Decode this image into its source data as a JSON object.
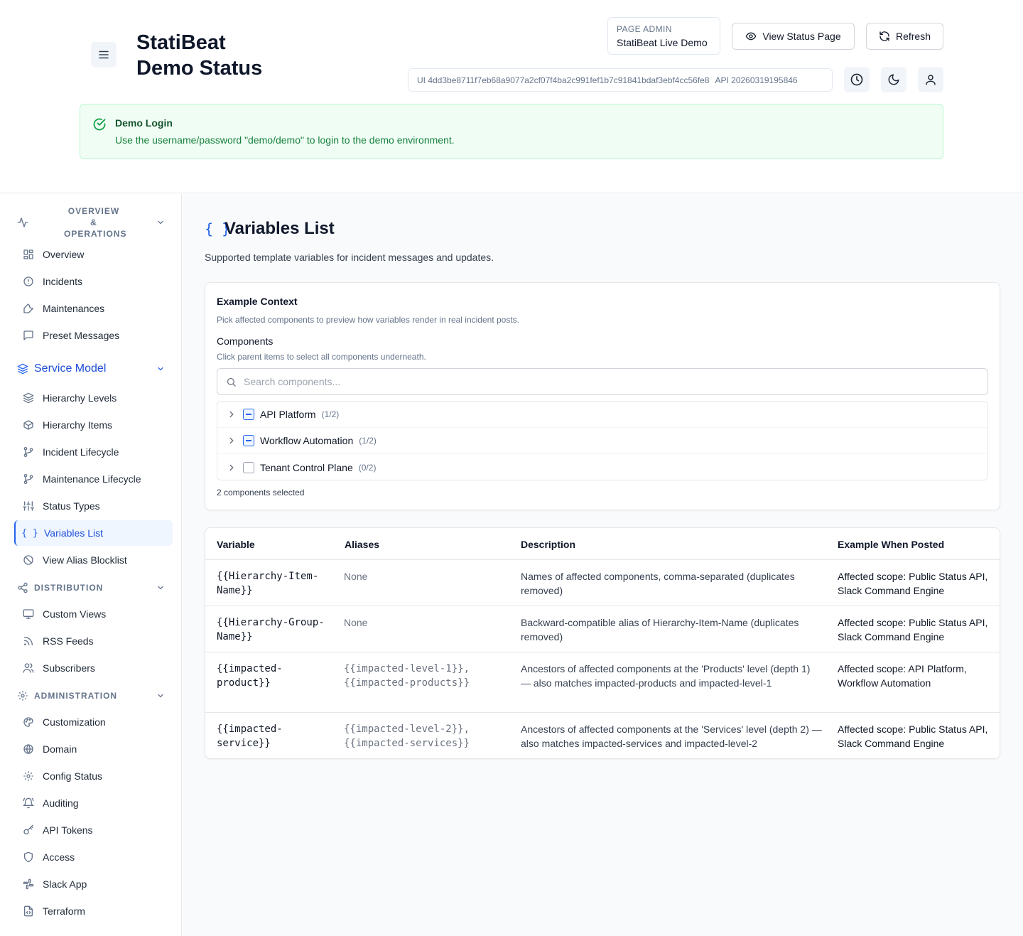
{
  "header": {
    "title_line1": "StatiBeat",
    "title_line2": "Demo Status",
    "page_admin_label": "PAGE ADMIN",
    "page_admin_value": "StatiBeat Live Demo",
    "view_status_label": "View Status Page",
    "refresh_label": "Refresh",
    "ui_version": "UI 4dd3be8711f7eb68a9077a2cf07f4ba2c991fef1b7c91841bdaf3ebf4cc56fe8",
    "api_version": "API 20260319195846"
  },
  "alert": {
    "title": "Demo Login",
    "text": "Use the username/password \"demo/demo\" to login to the demo environment.",
    "color": "#15803d"
  },
  "sidebar": {
    "sections": [
      {
        "label": "OVERVIEW & OPERATIONS",
        "line1": "OVERVIEW &",
        "line2": "OPERATIONS"
      },
      {
        "label": "Service Model"
      },
      {
        "label": "DISTRIBUTION"
      },
      {
        "label": "ADMINISTRATION"
      }
    ],
    "items": [
      {
        "label": "Overview",
        "icon": "grid-icon"
      },
      {
        "label": "Incidents",
        "icon": "alert-circle-icon"
      },
      {
        "label": "Maintenances",
        "icon": "wrench-icon"
      },
      {
        "label": "Preset Messages",
        "icon": "message-square-icon"
      },
      {
        "label": "Hierarchy Levels",
        "icon": "layers-icon"
      },
      {
        "label": "Hierarchy Items",
        "icon": "box-icon"
      },
      {
        "label": "Incident Lifecycle",
        "icon": "git-branch-icon"
      },
      {
        "label": "Maintenance Lifecycle",
        "icon": "git-branch-icon"
      },
      {
        "label": "Status Types",
        "icon": "sliders-icon"
      },
      {
        "label": "Variables List",
        "icon": "braces-icon",
        "active": true
      },
      {
        "label": "View Alias Blocklist",
        "icon": "ban-icon"
      },
      {
        "label": "Custom Views",
        "icon": "monitor-icon"
      },
      {
        "label": "RSS Feeds",
        "icon": "rss-icon"
      },
      {
        "label": "Subscribers",
        "icon": "users-icon"
      },
      {
        "label": "Customization",
        "icon": "palette-icon"
      },
      {
        "label": "Domain",
        "icon": "globe-icon"
      },
      {
        "label": "Config Status",
        "icon": "cog-icon"
      },
      {
        "label": "Auditing",
        "icon": "bell-ring-icon"
      },
      {
        "label": "API Tokens",
        "icon": "key-icon"
      },
      {
        "label": "Access",
        "icon": "shield-icon"
      },
      {
        "label": "Slack App",
        "icon": "slack-icon"
      },
      {
        "label": "Terraform",
        "icon": "file-code-icon"
      }
    ],
    "accent": "#2563eb"
  },
  "main": {
    "title_icon": "{ }",
    "title": "Variables List",
    "subtitle": "Supported template variables for incident messages and updates.",
    "context": {
      "heading": "Example Context",
      "description": "Pick affected components to preview how variables render in real incident posts.",
      "components_label": "Components",
      "components_help": "Click parent items to select all components underneath.",
      "search_placeholder": "Search components...",
      "tree": [
        {
          "name": "API Platform",
          "count": "(1/2)",
          "state": "partial"
        },
        {
          "name": "Workflow Automation",
          "count": "(1/2)",
          "state": "partial"
        },
        {
          "name": "Tenant Control Plane",
          "count": "(0/2)",
          "state": "none"
        }
      ],
      "selected_text": "2 components selected"
    },
    "table": {
      "headers": [
        "Variable",
        "Aliases",
        "Description",
        "Example When Posted"
      ],
      "rows": [
        {
          "variable": "{{Hierarchy-Item-Name}}",
          "aliases": "None",
          "description": "Names of affected components, comma-separated (duplicates removed)",
          "example": "Affected scope: Public Status API, Slack Command Engine"
        },
        {
          "variable": "{{Hierarchy-Group-Name}}",
          "aliases": "None",
          "description": "Backward-compatible alias of Hierarchy-Item-Name (duplicates removed)",
          "example": "Affected scope: Public Status API, Slack Command Engine"
        },
        {
          "variable": "{{impacted-product}}",
          "aliases": "{{impacted-level-1}}, {{impacted-products}}",
          "description": "Ancestors of affected components at the 'Products' level (depth 1) — also matches impacted-products and impacted-level-1",
          "example": "Affected scope: API Platform, Workflow Automation"
        },
        {
          "variable": "{{impacted-service}}",
          "aliases": "{{impacted-level-2}}, {{impacted-services}}",
          "description": "Ancestors of affected components at the 'Services' level (depth 2) — also matches impacted-services and impacted-level-2",
          "example": "Affected scope: Public Status API, Slack Command Engine"
        }
      ]
    }
  }
}
